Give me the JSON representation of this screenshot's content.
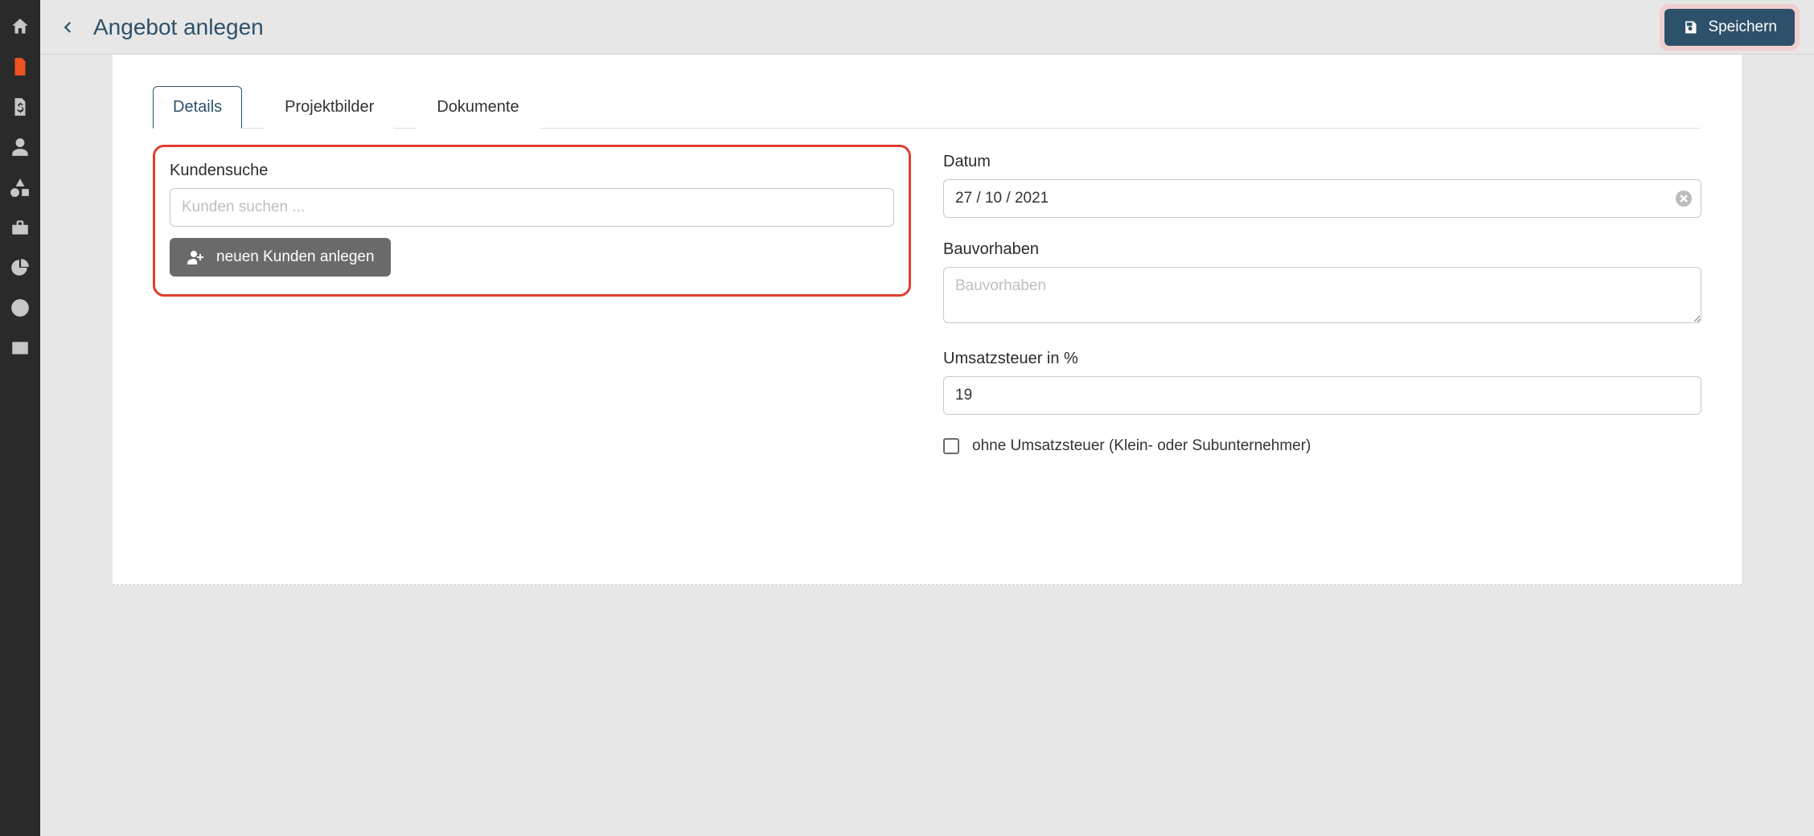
{
  "header": {
    "title": "Angebot anlegen",
    "save_label": "Speichern"
  },
  "tabs": [
    {
      "label": "Details",
      "active": true
    },
    {
      "label": "Projektbilder",
      "active": false
    },
    {
      "label": "Dokumente",
      "active": false
    }
  ],
  "form": {
    "customer_search": {
      "label": "Kundensuche",
      "placeholder": "Kunden suchen ...",
      "value": "",
      "new_button_label": "neuen Kunden anlegen"
    },
    "date": {
      "label": "Datum",
      "value": "27 / 10 / 2021"
    },
    "bauvorhaben": {
      "label": "Bauvorhaben",
      "placeholder": "Bauvorhaben",
      "value": ""
    },
    "vat": {
      "label": "Umsatzsteuer in %",
      "value": "19"
    },
    "vat_exempt": {
      "label": "ohne Umsatzsteuer (Klein- oder Subunternehmer)",
      "checked": false
    }
  },
  "sidebar": {
    "items": [
      {
        "name": "home"
      },
      {
        "name": "document",
        "active": true
      },
      {
        "name": "invoice"
      },
      {
        "name": "user"
      },
      {
        "name": "shapes"
      },
      {
        "name": "toolbox"
      },
      {
        "name": "chart"
      },
      {
        "name": "clock"
      },
      {
        "name": "id-card"
      }
    ]
  }
}
